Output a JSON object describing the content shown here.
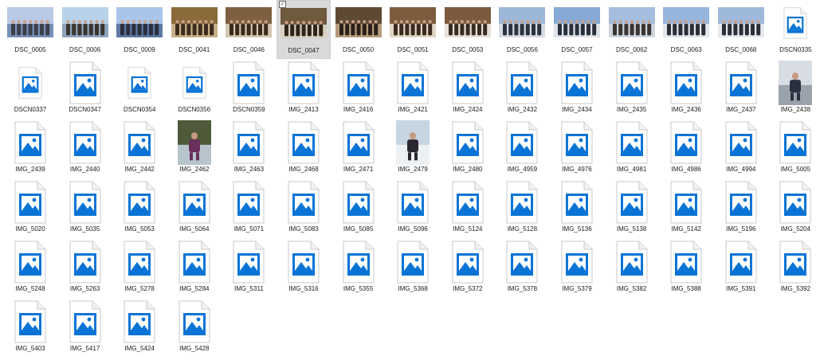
{
  "theme": {
    "accent": "#0a74d6",
    "selected_bg": "#d9d9d9"
  },
  "files": [
    {
      "name": "DSC_0005",
      "kind": "photo",
      "palette": [
        "#b9c9e6",
        "#7890b8",
        "#3c3f4a"
      ]
    },
    {
      "name": "DSC_0006",
      "kind": "photo",
      "palette": [
        "#b8d2ea",
        "#8fa5bd",
        "#3a3530"
      ]
    },
    {
      "name": "DSC_0009",
      "kind": "photo",
      "palette": [
        "#a9c6ea",
        "#5e78a3",
        "#2d2f3e"
      ]
    },
    {
      "name": "DSC_0041",
      "kind": "photo",
      "palette": [
        "#8a6a3a",
        "#c9b08a",
        "#3b2c1d"
      ]
    },
    {
      "name": "DSC_0046",
      "kind": "photo",
      "palette": [
        "#7e6040",
        "#d2c6b0",
        "#3a2a1b"
      ]
    },
    {
      "name": "DSC_0047",
      "kind": "photo",
      "palette": [
        "#6f5a3d",
        "#d8d0c0",
        "#2f2418"
      ],
      "selected": true
    },
    {
      "name": "DSC_0050",
      "kind": "photo",
      "palette": [
        "#5e4a34",
        "#b59d7c",
        "#2b2119"
      ]
    },
    {
      "name": "DSC_0051",
      "kind": "photo",
      "palette": [
        "#7d5c3e",
        "#e0d6c6",
        "#3b2a1e"
      ]
    },
    {
      "name": "DSC_0053",
      "kind": "photo",
      "palette": [
        "#7b5a3d",
        "#e6e0d6",
        "#3a2b20"
      ]
    },
    {
      "name": "DSC_0056",
      "kind": "photo",
      "palette": [
        "#9db7d8",
        "#d4dbe2",
        "#2c3240"
      ]
    },
    {
      "name": "DSC_0057",
      "kind": "photo",
      "palette": [
        "#87a9d6",
        "#dfe3e8",
        "#2a2f3c"
      ]
    },
    {
      "name": "DSC_0062",
      "kind": "photo",
      "palette": [
        "#a5bee0",
        "#cdd5dd",
        "#3a3430"
      ]
    },
    {
      "name": "DSC_0063",
      "kind": "photo",
      "palette": [
        "#97b6de",
        "#e2e6ea",
        "#2a2e38"
      ]
    },
    {
      "name": "DSC_0068",
      "kind": "photo",
      "palette": [
        "#9fb9db",
        "#e6e9ed",
        "#2c2f36"
      ]
    },
    {
      "name": "DSCN0335",
      "kind": "icon-small"
    },
    {
      "name": "DSCN0337",
      "kind": "icon-small"
    },
    {
      "name": "DSCN0347",
      "kind": "icon"
    },
    {
      "name": "DSCN0354",
      "kind": "icon-small"
    },
    {
      "name": "DSCN0356",
      "kind": "icon-small"
    },
    {
      "name": "DSCN0359",
      "kind": "icon"
    },
    {
      "name": "IMG_2413",
      "kind": "icon"
    },
    {
      "name": "IMG_2416",
      "kind": "icon"
    },
    {
      "name": "IMG_2421",
      "kind": "icon"
    },
    {
      "name": "IMG_2424",
      "kind": "icon"
    },
    {
      "name": "IMG_2432",
      "kind": "icon"
    },
    {
      "name": "IMG_2434",
      "kind": "icon"
    },
    {
      "name": "IMG_2435",
      "kind": "icon"
    },
    {
      "name": "IMG_2436",
      "kind": "icon"
    },
    {
      "name": "IMG_2437",
      "kind": "icon"
    },
    {
      "name": "IMG_2438",
      "kind": "photo-tall",
      "palette": [
        "#d8dde3",
        "#9aa2ab",
        "#2b3040"
      ]
    },
    {
      "name": "IMG_2439",
      "kind": "icon"
    },
    {
      "name": "IMG_2440",
      "kind": "icon"
    },
    {
      "name": "IMG_2442",
      "kind": "icon"
    },
    {
      "name": "IMG_2462",
      "kind": "photo-tall",
      "palette": [
        "#4e5a3a",
        "#b7c4cc",
        "#6a2f5a"
      ]
    },
    {
      "name": "IMG_2463",
      "kind": "icon"
    },
    {
      "name": "IMG_2468",
      "kind": "icon"
    },
    {
      "name": "IMG_2471",
      "kind": "icon"
    },
    {
      "name": "IMG_2479",
      "kind": "photo-tall",
      "palette": [
        "#c7d4e2",
        "#eef1f4",
        "#2a2730"
      ]
    },
    {
      "name": "IMG_2480",
      "kind": "icon"
    },
    {
      "name": "IMG_4959",
      "kind": "icon"
    },
    {
      "name": "IMG_4976",
      "kind": "icon"
    },
    {
      "name": "IMG_4981",
      "kind": "icon"
    },
    {
      "name": "IMG_4986",
      "kind": "icon"
    },
    {
      "name": "IMG_4994",
      "kind": "icon"
    },
    {
      "name": "IMG_5005",
      "kind": "icon"
    },
    {
      "name": "IMG_5020",
      "kind": "icon"
    },
    {
      "name": "IMG_5035",
      "kind": "icon"
    },
    {
      "name": "IMG_5053",
      "kind": "icon"
    },
    {
      "name": "IMG_5064",
      "kind": "icon"
    },
    {
      "name": "IMG_5071",
      "kind": "icon"
    },
    {
      "name": "IMG_5083",
      "kind": "icon"
    },
    {
      "name": "IMG_5085",
      "kind": "icon"
    },
    {
      "name": "IMG_5096",
      "kind": "icon"
    },
    {
      "name": "IMG_5124",
      "kind": "icon"
    },
    {
      "name": "IMG_5128",
      "kind": "icon"
    },
    {
      "name": "IMG_5136",
      "kind": "icon"
    },
    {
      "name": "IMG_5138",
      "kind": "icon"
    },
    {
      "name": "IMG_5142",
      "kind": "icon"
    },
    {
      "name": "IMG_5196",
      "kind": "icon"
    },
    {
      "name": "IMG_5204",
      "kind": "icon"
    },
    {
      "name": "IMG_5248",
      "kind": "icon"
    },
    {
      "name": "IMG_5263",
      "kind": "icon"
    },
    {
      "name": "IMG_5278",
      "kind": "icon"
    },
    {
      "name": "IMG_5284",
      "kind": "icon"
    },
    {
      "name": "IMG_5311",
      "kind": "icon"
    },
    {
      "name": "IMG_5316",
      "kind": "icon"
    },
    {
      "name": "IMG_5355",
      "kind": "icon"
    },
    {
      "name": "IMG_5368",
      "kind": "icon"
    },
    {
      "name": "IMG_5372",
      "kind": "icon"
    },
    {
      "name": "IMG_5378",
      "kind": "icon"
    },
    {
      "name": "IMG_5379",
      "kind": "icon"
    },
    {
      "name": "IMG_5382",
      "kind": "icon"
    },
    {
      "name": "IMG_5388",
      "kind": "icon"
    },
    {
      "name": "IMG_5391",
      "kind": "icon"
    },
    {
      "name": "IMG_5392",
      "kind": "icon"
    },
    {
      "name": "IMG_5403",
      "kind": "icon"
    },
    {
      "name": "IMG_5417",
      "kind": "icon"
    },
    {
      "name": "IMG_5424",
      "kind": "icon"
    },
    {
      "name": "IMG_5428",
      "kind": "icon"
    }
  ]
}
